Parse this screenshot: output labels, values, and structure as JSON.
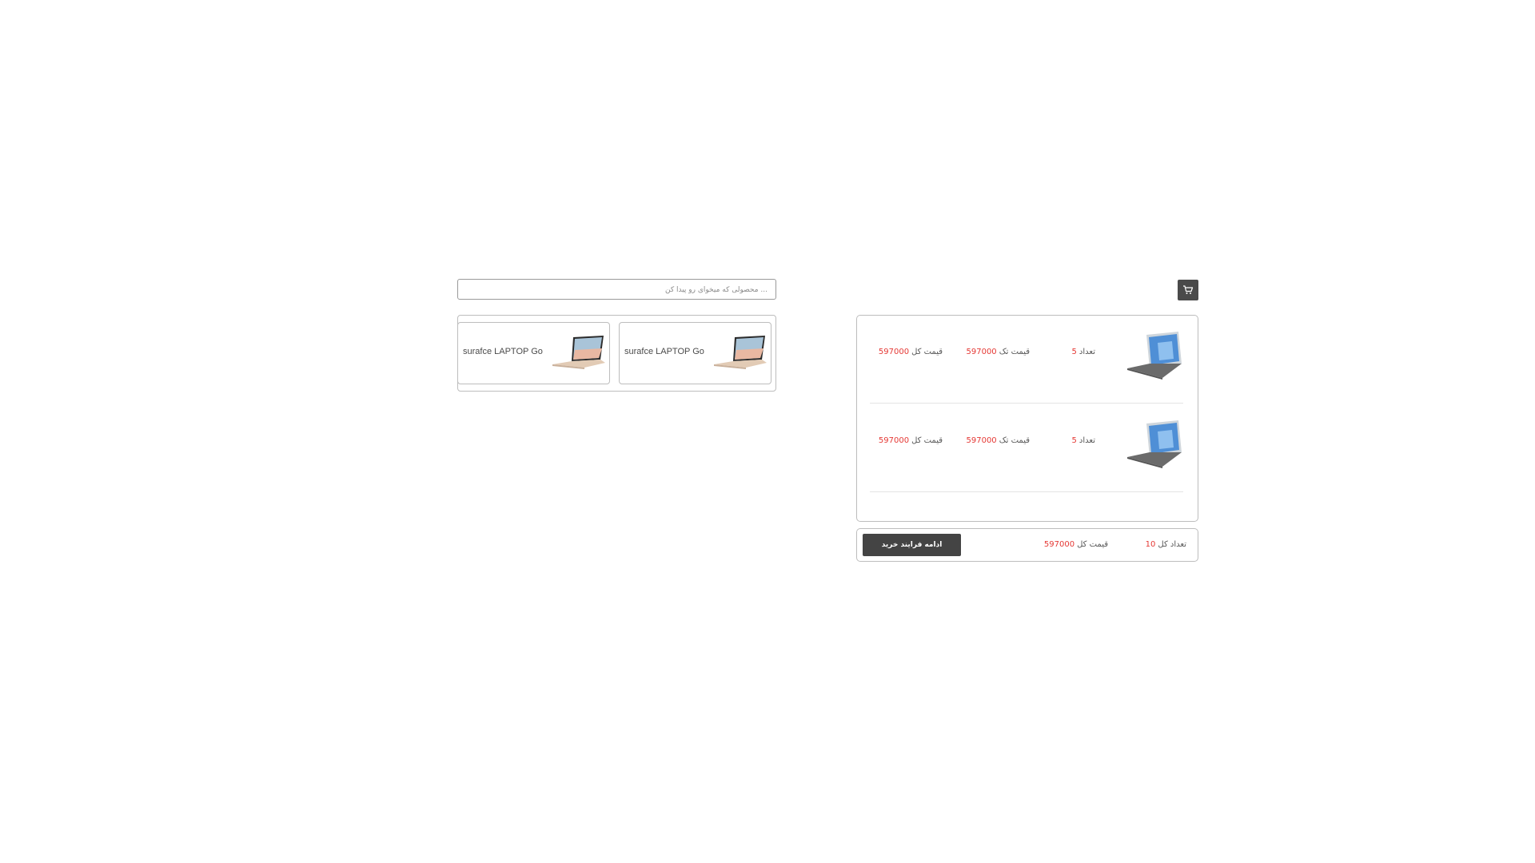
{
  "search": {
    "placeholder": "... محصولی که میخوای رو پیدا کن"
  },
  "products": [
    {
      "name": "surafce LAPTOP Go",
      "image": "laptop-icon"
    },
    {
      "name": "surafce LAPTOP Go",
      "image": "laptop-icon"
    }
  ],
  "cart": {
    "icon": "shopping-cart-icon",
    "items": [
      {
        "qty_label": "تعداد",
        "qty": "5",
        "unit_label": "قیمت تک",
        "unit_price": "597000",
        "total_label": "قیمت کل",
        "total_price": "597000",
        "image": "tablet-icon"
      },
      {
        "qty_label": "تعداد",
        "qty": "5",
        "unit_label": "قیمت تک",
        "unit_price": "597000",
        "total_label": "قیمت کل",
        "total_price": "597000",
        "image": "tablet-icon"
      }
    ],
    "summary": {
      "qty_label": "تعداد کل",
      "qty": "10",
      "total_label": "قیمت کل",
      "total": "597000",
      "checkout_label": "ادامه فرایند خرید"
    }
  },
  "colors": {
    "accent_red": "#e53935",
    "dark_button": "#444444",
    "border": "#bdbdbd"
  }
}
